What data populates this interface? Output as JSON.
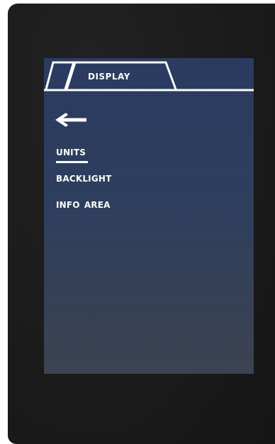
{
  "header": {
    "tab_label": "DISPLAY"
  },
  "navigation": {
    "back_icon": "left-arrow-icon"
  },
  "menu": {
    "items": [
      {
        "label": "UNITS",
        "selected": true
      },
      {
        "label": "BACKLIGHT",
        "selected": false
      },
      {
        "label": "INFO AREA",
        "selected": false
      }
    ]
  },
  "colors": {
    "bezel": "#1b1b1b",
    "screen": "#2b3c5c",
    "text": "#ffffff"
  }
}
